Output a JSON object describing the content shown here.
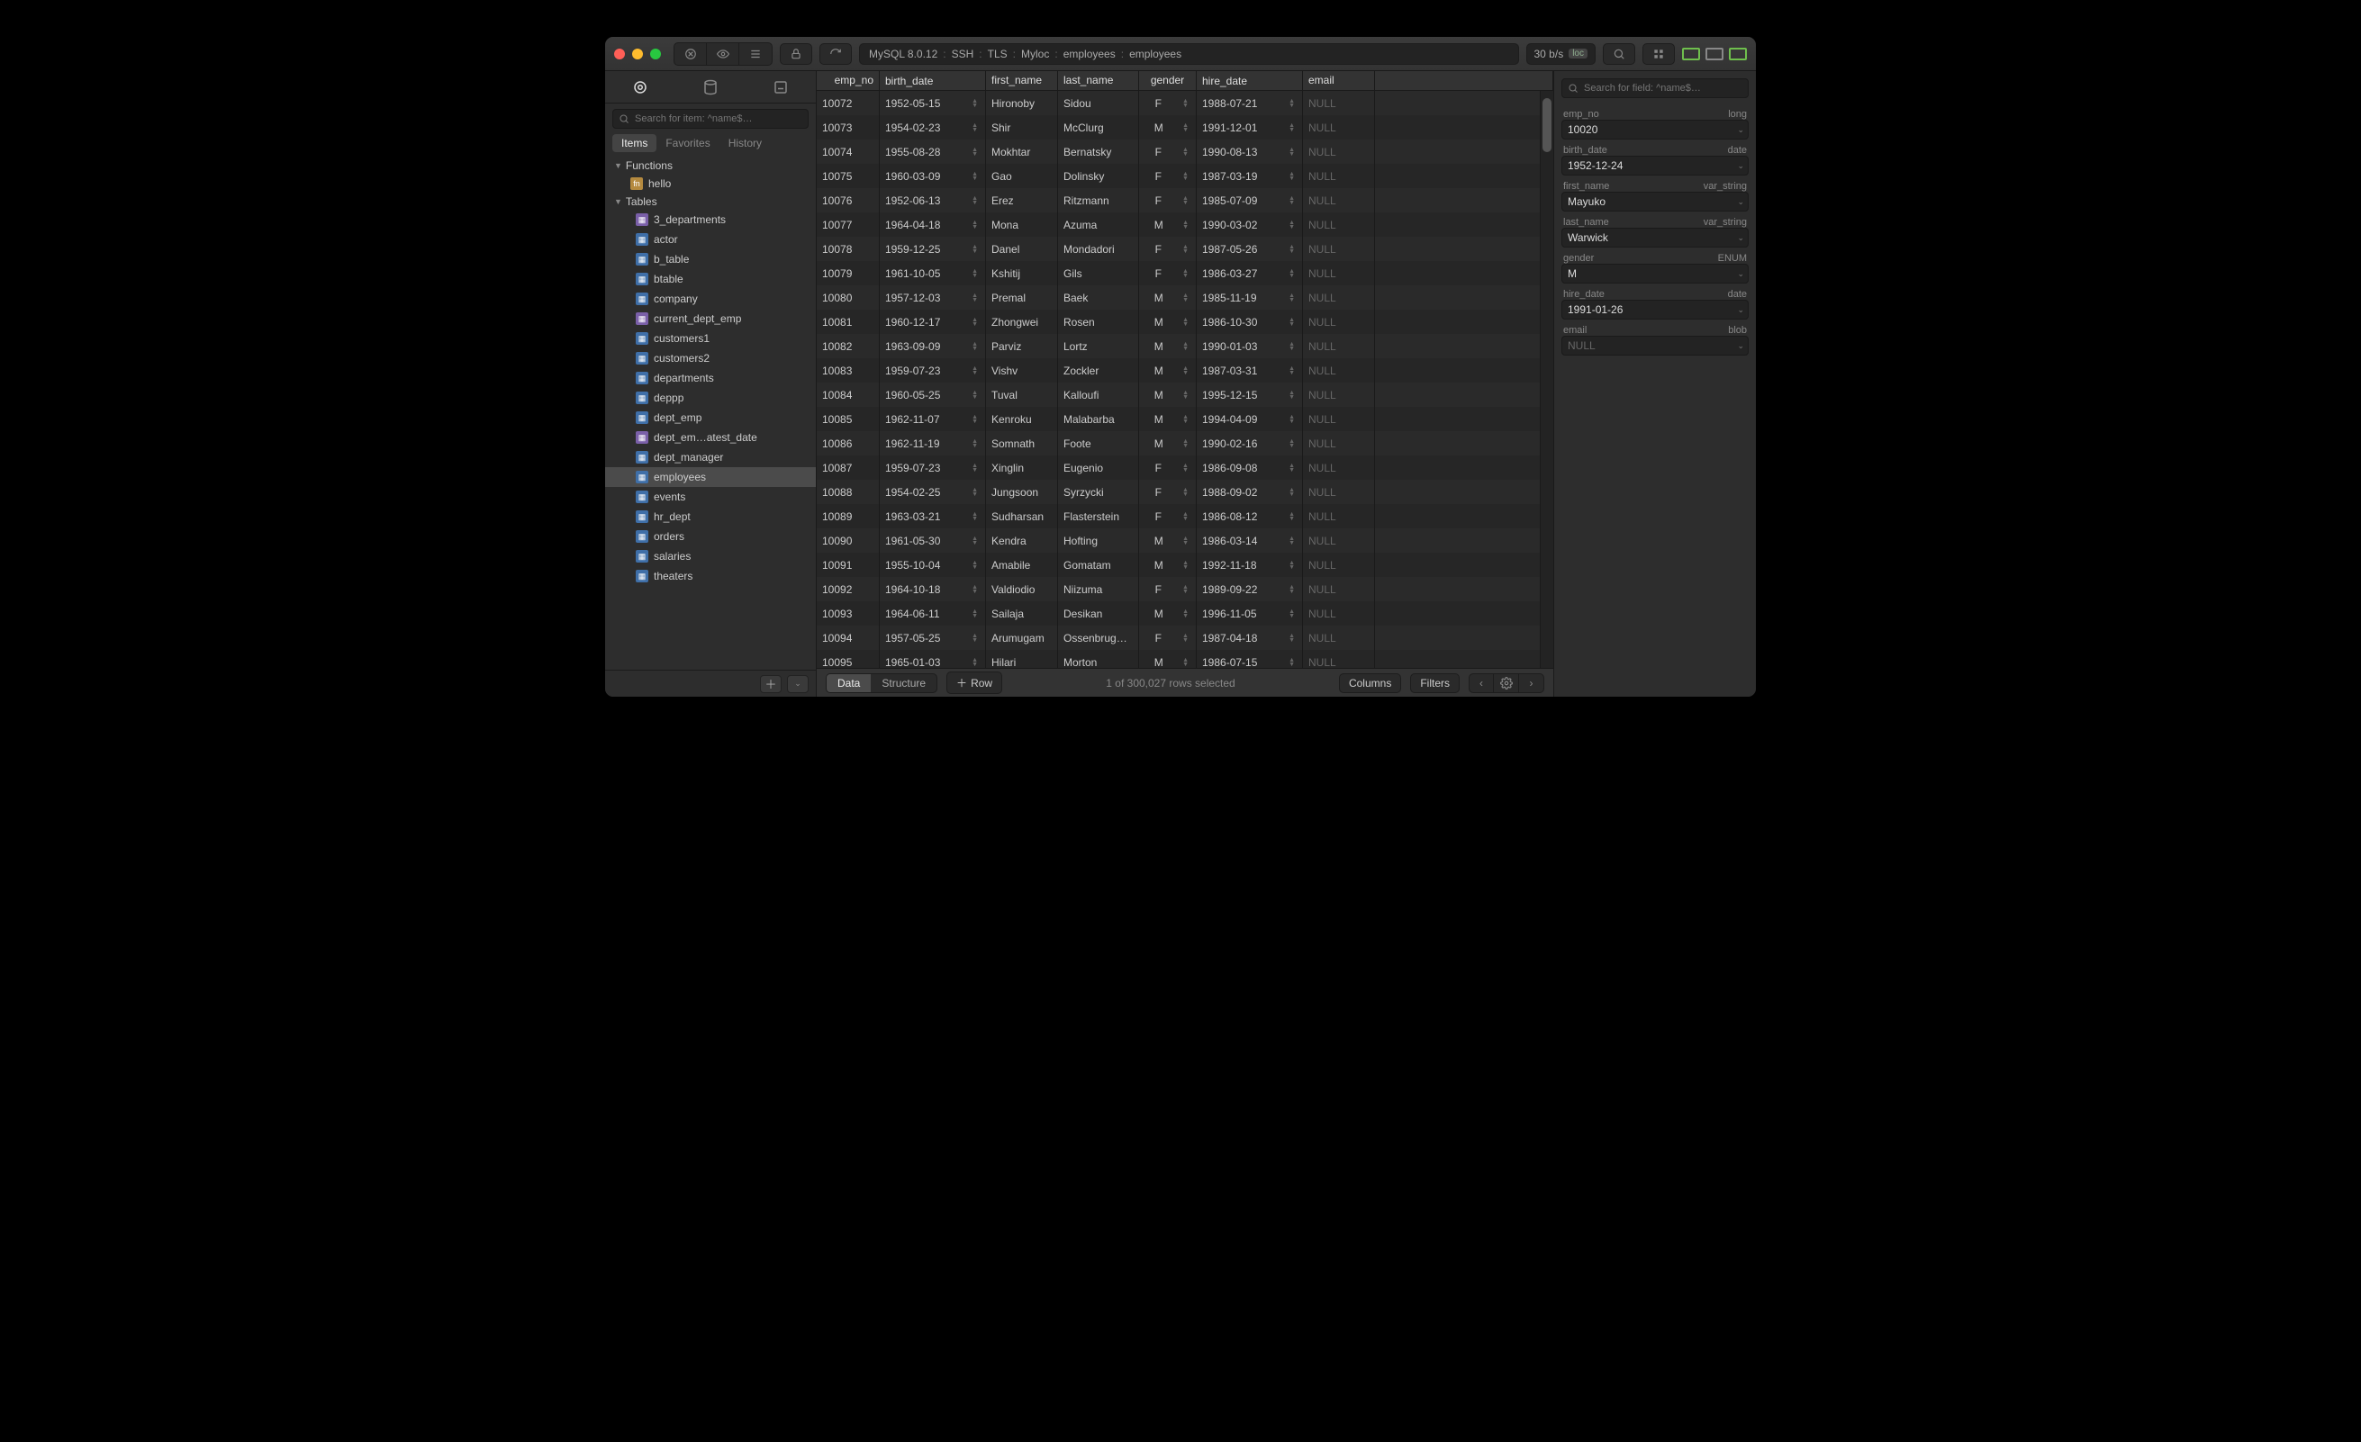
{
  "titlebar": {
    "breadcrumb": [
      "MySQL 8.0.12",
      "SSH",
      "TLS",
      "Myloc",
      "employees",
      "employees"
    ],
    "bandwidth": "30 b/s",
    "loc_badge": "loc"
  },
  "sidebar": {
    "search_placeholder": "Search for item: ^name$…",
    "tabs": [
      "Items",
      "Favorites",
      "History"
    ],
    "active_tab": 0,
    "sections": [
      {
        "name": "Functions",
        "items": [
          {
            "label": "hello",
            "type": "func"
          }
        ]
      },
      {
        "name": "Tables",
        "items": [
          {
            "label": "3_departments",
            "type": "view"
          },
          {
            "label": "actor",
            "type": "table"
          },
          {
            "label": "b_table",
            "type": "table"
          },
          {
            "label": "btable",
            "type": "table"
          },
          {
            "label": "company",
            "type": "table"
          },
          {
            "label": "current_dept_emp",
            "type": "view"
          },
          {
            "label": "customers1",
            "type": "table"
          },
          {
            "label": "customers2",
            "type": "table"
          },
          {
            "label": "departments",
            "type": "table"
          },
          {
            "label": "deppp",
            "type": "table"
          },
          {
            "label": "dept_emp",
            "type": "table"
          },
          {
            "label": "dept_em…atest_date",
            "type": "view"
          },
          {
            "label": "dept_manager",
            "type": "table"
          },
          {
            "label": "employees",
            "type": "table",
            "selected": true
          },
          {
            "label": "events",
            "type": "table"
          },
          {
            "label": "hr_dept",
            "type": "table"
          },
          {
            "label": "orders",
            "type": "table"
          },
          {
            "label": "salaries",
            "type": "table"
          },
          {
            "label": "theaters",
            "type": "table"
          }
        ]
      }
    ]
  },
  "grid": {
    "columns": [
      "emp_no",
      "birth_date",
      "first_name",
      "last_name",
      "gender",
      "hire_date",
      "email"
    ],
    "rows": [
      [
        "10072",
        "1952-05-15",
        "Hironoby",
        "Sidou",
        "F",
        "1988-07-21",
        "NULL"
      ],
      [
        "10073",
        "1954-02-23",
        "Shir",
        "McClurg",
        "M",
        "1991-12-01",
        "NULL"
      ],
      [
        "10074",
        "1955-08-28",
        "Mokhtar",
        "Bernatsky",
        "F",
        "1990-08-13",
        "NULL"
      ],
      [
        "10075",
        "1960-03-09",
        "Gao",
        "Dolinsky",
        "F",
        "1987-03-19",
        "NULL"
      ],
      [
        "10076",
        "1952-06-13",
        "Erez",
        "Ritzmann",
        "F",
        "1985-07-09",
        "NULL"
      ],
      [
        "10077",
        "1964-04-18",
        "Mona",
        "Azuma",
        "M",
        "1990-03-02",
        "NULL"
      ],
      [
        "10078",
        "1959-12-25",
        "Danel",
        "Mondadori",
        "F",
        "1987-05-26",
        "NULL"
      ],
      [
        "10079",
        "1961-10-05",
        "Kshitij",
        "Gils",
        "F",
        "1986-03-27",
        "NULL"
      ],
      [
        "10080",
        "1957-12-03",
        "Premal",
        "Baek",
        "M",
        "1985-11-19",
        "NULL"
      ],
      [
        "10081",
        "1960-12-17",
        "Zhongwei",
        "Rosen",
        "M",
        "1986-10-30",
        "NULL"
      ],
      [
        "10082",
        "1963-09-09",
        "Parviz",
        "Lortz",
        "M",
        "1990-01-03",
        "NULL"
      ],
      [
        "10083",
        "1959-07-23",
        "Vishv",
        "Zockler",
        "M",
        "1987-03-31",
        "NULL"
      ],
      [
        "10084",
        "1960-05-25",
        "Tuval",
        "Kalloufi",
        "M",
        "1995-12-15",
        "NULL"
      ],
      [
        "10085",
        "1962-11-07",
        "Kenroku",
        "Malabarba",
        "M",
        "1994-04-09",
        "NULL"
      ],
      [
        "10086",
        "1962-11-19",
        "Somnath",
        "Foote",
        "M",
        "1990-02-16",
        "NULL"
      ],
      [
        "10087",
        "1959-07-23",
        "Xinglin",
        "Eugenio",
        "F",
        "1986-09-08",
        "NULL"
      ],
      [
        "10088",
        "1954-02-25",
        "Jungsoon",
        "Syrzycki",
        "F",
        "1988-09-02",
        "NULL"
      ],
      [
        "10089",
        "1963-03-21",
        "Sudharsan",
        "Flasterstein",
        "F",
        "1986-08-12",
        "NULL"
      ],
      [
        "10090",
        "1961-05-30",
        "Kendra",
        "Hofting",
        "M",
        "1986-03-14",
        "NULL"
      ],
      [
        "10091",
        "1955-10-04",
        "Amabile",
        "Gomatam",
        "M",
        "1992-11-18",
        "NULL"
      ],
      [
        "10092",
        "1964-10-18",
        "Valdiodio",
        "Niizuma",
        "F",
        "1989-09-22",
        "NULL"
      ],
      [
        "10093",
        "1964-06-11",
        "Sailaja",
        "Desikan",
        "M",
        "1996-11-05",
        "NULL"
      ],
      [
        "10094",
        "1957-05-25",
        "Arumugam",
        "Ossenbrug…",
        "F",
        "1987-04-18",
        "NULL"
      ],
      [
        "10095",
        "1965-01-03",
        "Hilari",
        "Morton",
        "M",
        "1986-07-15",
        "NULL"
      ]
    ]
  },
  "footer": {
    "seg": [
      "Data",
      "Structure"
    ],
    "seg_active": 0,
    "row_btn": "Row",
    "status": "1 of 300,027 rows selected",
    "columns_btn": "Columns",
    "filters_btn": "Filters"
  },
  "inspector": {
    "search_placeholder": "Search for field: ^name$…",
    "fields": [
      {
        "name": "emp_no",
        "type": "long",
        "value": "10020"
      },
      {
        "name": "birth_date",
        "type": "date",
        "value": "1952-12-24"
      },
      {
        "name": "first_name",
        "type": "var_string",
        "value": "Mayuko"
      },
      {
        "name": "last_name",
        "type": "var_string",
        "value": "Warwick"
      },
      {
        "name": "gender",
        "type": "ENUM",
        "value": "M"
      },
      {
        "name": "hire_date",
        "type": "date",
        "value": "1991-01-26"
      },
      {
        "name": "email",
        "type": "blob",
        "value": "NULL",
        "null": true
      }
    ]
  }
}
